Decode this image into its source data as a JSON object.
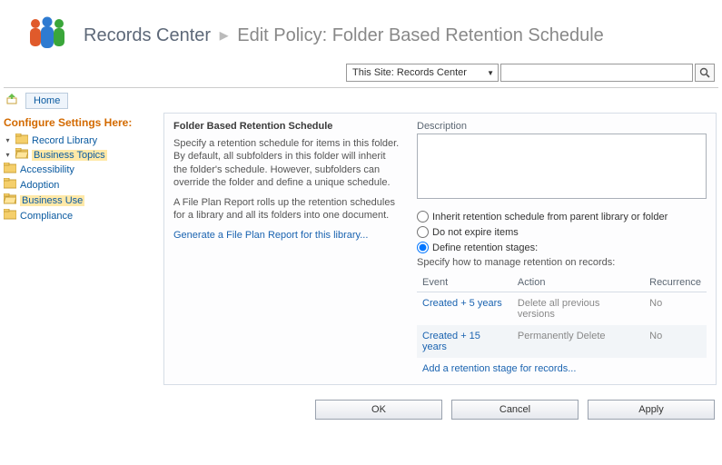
{
  "header": {
    "site_title": "Records Center",
    "page_title": "Edit Policy: Folder Based Retention Schedule"
  },
  "search": {
    "scope_label": "This Site: Records Center",
    "query": ""
  },
  "crumb": {
    "home_label": "Home"
  },
  "leftnav": {
    "section_title": "Configure Settings Here:",
    "root": {
      "label": "Record Library",
      "children": [
        {
          "label": "Business Topics",
          "children": [
            {
              "label": "Accessibility"
            },
            {
              "label": "Adoption"
            },
            {
              "label": "Business Use",
              "selected": true
            },
            {
              "label": "Compliance"
            }
          ]
        }
      ]
    }
  },
  "policy": {
    "heading": "Folder Based Retention Schedule",
    "para1": "Specify a retention schedule for items in this folder. By default, all subfolders in this folder will inherit the folder's schedule. However, subfolders can override the folder and define a unique schedule.",
    "para2": "A File Plan Report rolls up the retention schedules for a library and all its folders into one document.",
    "report_link": "Generate a File Plan Report for this library..."
  },
  "form": {
    "desc_label": "Description",
    "desc_value": "",
    "options": {
      "inherit": "Inherit retention schedule from parent library or folder",
      "noexpire": "Do not expire items",
      "stages": "Define retention stages:",
      "selected": "stages"
    },
    "stages_hint": "Specify how to manage retention on records:",
    "columns": {
      "event": "Event",
      "action": "Action",
      "recurrence": "Recurrence"
    },
    "stages": [
      {
        "event": "Created + 5 years",
        "action": "Delete all previous versions",
        "recurrence": "No"
      },
      {
        "event": "Created + 15 years",
        "action": "Permanently Delete",
        "recurrence": "No"
      }
    ],
    "add_stage_link": "Add a retention stage for records..."
  },
  "buttons": {
    "ok": "OK",
    "cancel": "Cancel",
    "apply": "Apply"
  }
}
